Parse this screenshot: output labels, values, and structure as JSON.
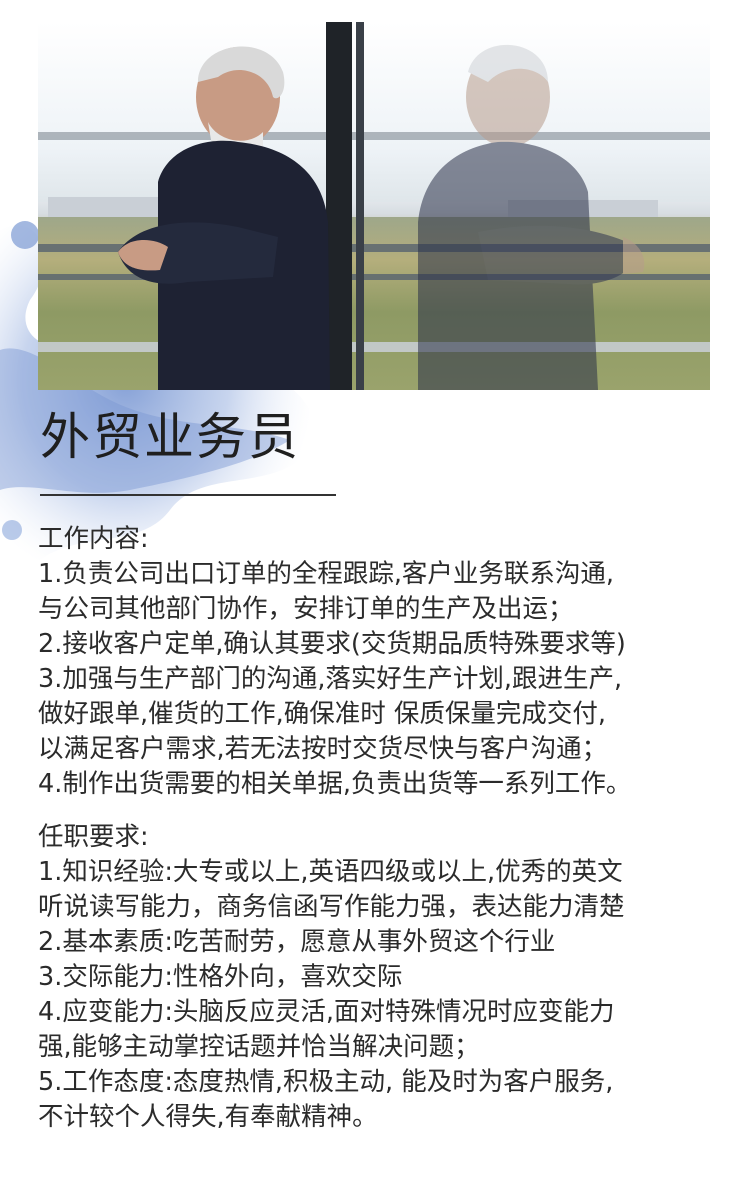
{
  "title": "外贸业务员",
  "job_content": {
    "heading": "工作内容:",
    "lines": [
      "1.负责公司出口订单的全程跟踪,客户业务联系沟通,",
      "与公司其他部门协作，安排订单的生产及出运；",
      "2.接收客户定单,确认其要求(交货期品质特殊要求等)",
      "3.加强与生产部门的沟通,落实好生产计划,跟进生产,",
      "做好跟单,催货的工作,确保准时 保质保量完成交付,",
      "以满足客户需求,若无法按时交货尽快与客户沟通；",
      "4.制作出货需要的相关单据,负责出货等一系列工作。"
    ]
  },
  "requirements": {
    "heading": "任职要求:",
    "lines": [
      "1.知识经验:大专或以上,英语四级或以上,优秀的英文",
      "听说读写能力，商务信函写作能力强，表达能力清楚",
      "2.基本素质:吃苦耐劳，愿意从事外贸这个行业",
      "3.交际能力:性格外向，喜欢交际",
      "4.应变能力:头脑反应灵活,面对特殊情况时应变能力",
      "强,能够主动掌控话题并恰当解决问题；",
      "5.工作态度:态度热情,积极主动, 能及时为客户服务,",
      "不计较个人得失,有奉献精神。"
    ]
  },
  "colors": {
    "splash": "#7f9fd4",
    "text": "#2b2b2b",
    "suit": "#1e2233"
  }
}
